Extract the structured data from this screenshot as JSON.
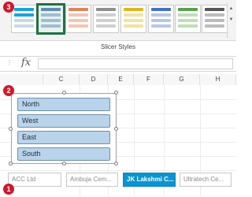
{
  "ribbon": {
    "group_label": "Slicer Styles",
    "styles": [
      {
        "name": "style-1",
        "colors": [
          "#1aa3dd",
          "#1aa3dd",
          "#c9d8e6",
          "#c9d8e6"
        ]
      },
      {
        "name": "style-2",
        "colors": [
          "#5c8db5",
          "#9fbcd6",
          "#9fbcd6",
          "#9fbcd6"
        ],
        "selected": true
      },
      {
        "name": "style-3",
        "colors": [
          "#e2845a",
          "#f2c6b3",
          "#f2c6b3",
          "#f2c6b3"
        ]
      },
      {
        "name": "style-4",
        "colors": [
          "#8e8e8e",
          "#cfcfcf",
          "#cfcfcf",
          "#cfcfcf"
        ]
      },
      {
        "name": "style-5",
        "colors": [
          "#e0b51c",
          "#f3e2a0",
          "#f3e2a0",
          "#f3e2a0"
        ]
      },
      {
        "name": "style-6",
        "colors": [
          "#4472c4",
          "#b7c7e8",
          "#b7c7e8",
          "#b7c7e8"
        ]
      },
      {
        "name": "style-7",
        "colors": [
          "#5aa14c",
          "#bfe0b6",
          "#bfe0b6",
          "#bfe0b6"
        ]
      },
      {
        "name": "style-8",
        "colors": [
          "#555555",
          "#bcbcbc",
          "#bcbcbc",
          "#bcbcbc"
        ]
      }
    ],
    "scroll_up": "▲",
    "scroll_down": "▼"
  },
  "formula_bar": {
    "fx_label": "fx",
    "separator": "⋮",
    "value": ""
  },
  "columns": [
    "C",
    "D",
    "E",
    "F",
    "G",
    "H"
  ],
  "slicer": {
    "items": [
      "North",
      "West",
      "East",
      "South"
    ]
  },
  "horizontal_slicer": {
    "items": [
      "ACC Ltd",
      "Ambuja Cem...",
      "JK Lakshmi C...",
      "Ultratech Ce..."
    ],
    "active_index": 2
  },
  "badges": [
    "3",
    "2",
    "1"
  ],
  "colors": {
    "accent": "#0b93d1",
    "badge": "#d0182b",
    "slicer_item": "#b9d3ea"
  }
}
